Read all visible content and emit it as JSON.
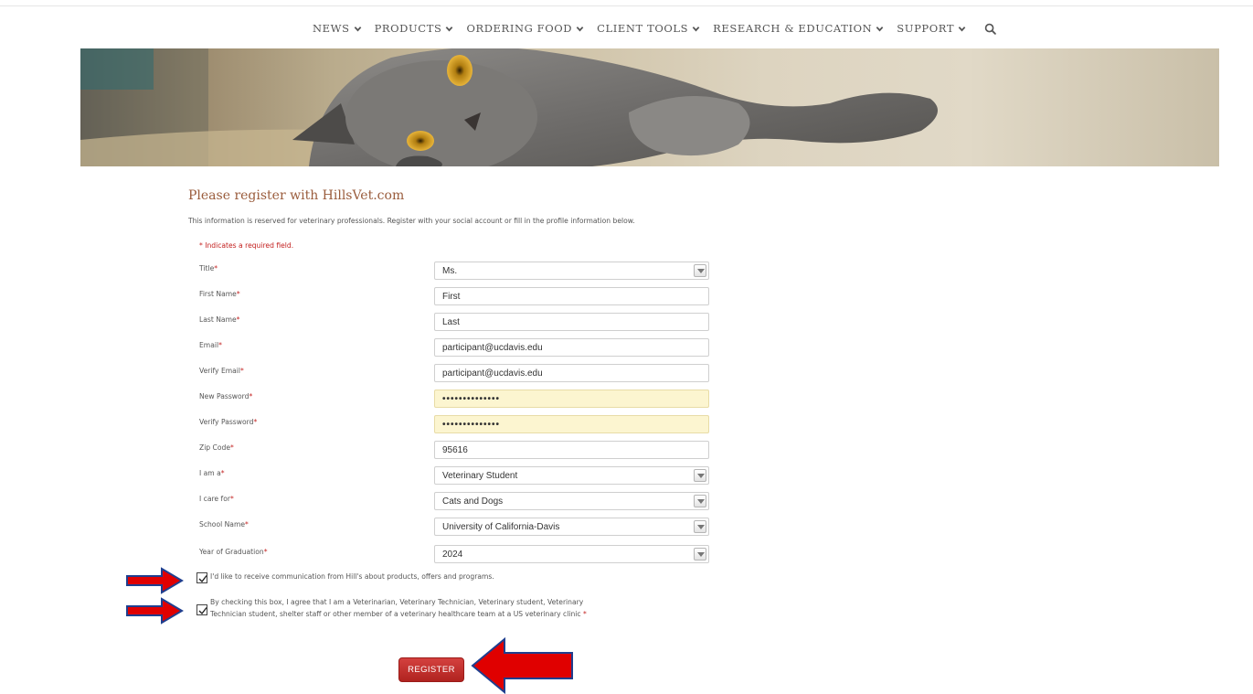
{
  "nav": {
    "items": [
      {
        "label": "NEWS"
      },
      {
        "label": "PRODUCTS"
      },
      {
        "label": "ORDERING FOOD"
      },
      {
        "label": "CLIENT TOOLS"
      },
      {
        "label": "RESEARCH & EDUCATION"
      },
      {
        "label": "SUPPORT"
      }
    ],
    "search_icon": "search-icon"
  },
  "form": {
    "heading": "Please register with HillsVet.com",
    "intro": "This information is reserved for veterinary professionals. Register with your social account or fill in the profile information below.",
    "required_note": "* Indicates a required field.",
    "required_marker": "*",
    "fields": {
      "title": {
        "label": "Title",
        "value": "Ms."
      },
      "first_name": {
        "label": "First Name",
        "value": "First"
      },
      "last_name": {
        "label": "Last Name",
        "value": "Last"
      },
      "email": {
        "label": "Email",
        "value": "participant@ucdavis.edu"
      },
      "verify_email": {
        "label": "Verify Email",
        "value": "participant@ucdavis.edu"
      },
      "new_password": {
        "label": "New Password",
        "value": "••••••••••••••"
      },
      "verify_password": {
        "label": "Verify Password",
        "value": "••••••••••••••"
      },
      "zip_code": {
        "label": "Zip Code",
        "value": "95616"
      },
      "i_am_a": {
        "label": "I am a",
        "value": "Veterinary Student"
      },
      "i_care_for": {
        "label": "I care for",
        "value": "Cats and Dogs"
      },
      "school_name": {
        "label": "School Name",
        "value": "University of California-Davis"
      },
      "year_of_graduation": {
        "label": "Year of Graduation",
        "value": "2024"
      }
    },
    "checkboxes": {
      "communication": {
        "label": "I'd like to receive communication from Hill's about products, offers and programs.",
        "checked": true
      },
      "agreement": {
        "label_line1": "By checking this box, I agree that I am a Veterinarian, Veterinary Technician, Veterinary student, Veterinary",
        "label_line2": "Technician student, shelter staff or other member of a veterinary healthcare team at a US veterinary clinic",
        "checked": true
      }
    },
    "register_label": "REGISTER"
  },
  "colors": {
    "accent": "#9a5c3c",
    "required": "#c3201f",
    "button": "#c0302d",
    "annotation_arrow": "#e00000",
    "arrow_outline": "#1f3f8f"
  }
}
